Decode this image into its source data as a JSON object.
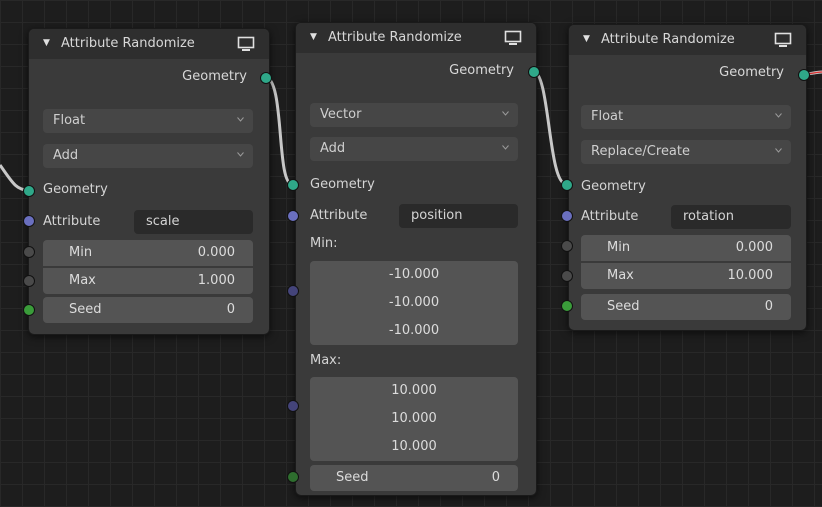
{
  "nodes": [
    {
      "title": "Attribute Randomize",
      "output_label": "Geometry",
      "data_type": "Float",
      "operation": "Add",
      "input_geometry": "Geometry",
      "attribute_label": "Attribute",
      "attribute_value": "scale",
      "min_label": "Min",
      "min_value": "0.000",
      "max_label": "Max",
      "max_value": "1.000",
      "seed_label": "Seed",
      "seed_value": "0"
    },
    {
      "title": "Attribute Randomize",
      "output_label": "Geometry",
      "data_type": "Vector",
      "operation": "Add",
      "input_geometry": "Geometry",
      "attribute_label": "Attribute",
      "attribute_value": "position",
      "min_label": "Min:",
      "min_values": [
        "-10.000",
        "-10.000",
        "-10.000"
      ],
      "max_label": "Max:",
      "max_values": [
        "10.000",
        "10.000",
        "10.000"
      ],
      "seed_label": "Seed",
      "seed_value": "0"
    },
    {
      "title": "Attribute Randomize",
      "output_label": "Geometry",
      "data_type": "Float",
      "operation": "Replace/Create",
      "input_geometry": "Geometry",
      "attribute_label": "Attribute",
      "attribute_value": "rotation",
      "min_label": "Min",
      "min_value": "0.000",
      "max_label": "Max",
      "max_value": "10.000",
      "seed_label": "Seed",
      "seed_value": "0"
    }
  ],
  "icons": {
    "collapse": "triangle-down",
    "preview": "monitor-icon",
    "dropdown": "chevron-down-icon"
  },
  "colors": {
    "geometry_socket": "#2fa889",
    "string_socket": "#6a6fbf",
    "float_socket": "#8a8a8a",
    "int_socket": "#3a9c3a",
    "vector_socket": "#5959b8",
    "link_selected": "#e03030",
    "link": "#c8c8c8"
  }
}
